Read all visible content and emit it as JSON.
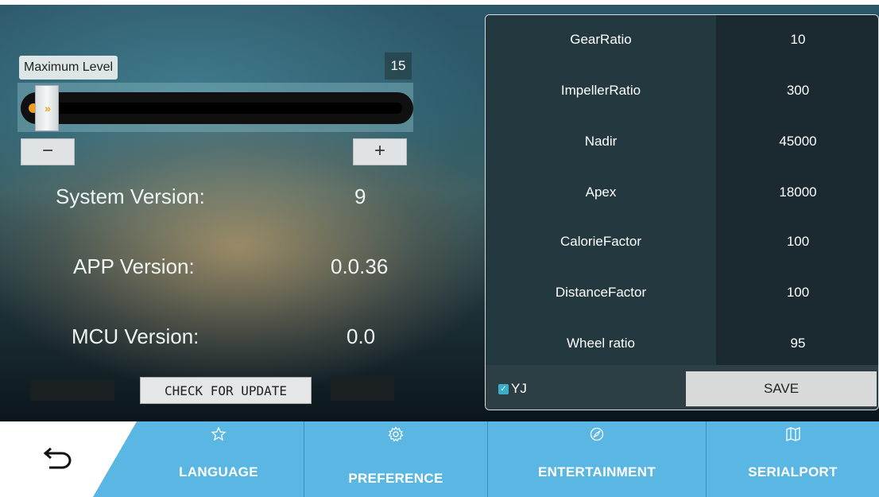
{
  "slider": {
    "label": "Maximum Level",
    "value": "15",
    "level_fraction": 0.0,
    "minus_label": "−",
    "plus_label": "+"
  },
  "versions": {
    "system_label": "System  Version:",
    "system_value": "9",
    "app_label": "APP  Version:",
    "app_value": "0.0.36",
    "mcu_label": "MCU  Version:",
    "mcu_value": "0.0"
  },
  "update_button": "CHECK FOR UPDATE",
  "params": [
    {
      "name": "GearRatio",
      "value": "10"
    },
    {
      "name": "ImpellerRatio",
      "value": "300"
    },
    {
      "name": "Nadir",
      "value": "45000"
    },
    {
      "name": "Apex",
      "value": "18000"
    },
    {
      "name": "CalorieFactor",
      "value": "100"
    },
    {
      "name": "DistanceFactor",
      "value": "100"
    },
    {
      "name": "Wheel ratio",
      "value": "95"
    }
  ],
  "panel_footer": {
    "checkbox_label": "YJ",
    "checkbox_checked": true,
    "save_label": "SAVE"
  },
  "nav": {
    "back_icon": "back-arrow-icon",
    "tabs": [
      {
        "label": "LANGUAGE",
        "icon": "star-icon"
      },
      {
        "label": "PREFERENCE",
        "icon": "gear-icon"
      },
      {
        "label": "ENTERTAINMENT",
        "icon": "compass-icon"
      },
      {
        "label": "SERIALPORT",
        "icon": "map-icon"
      }
    ]
  },
  "colors": {
    "nav_bg": "#5ab6e2",
    "accent_orange": "#f0a020",
    "checkbox": "#3ab0c8"
  }
}
